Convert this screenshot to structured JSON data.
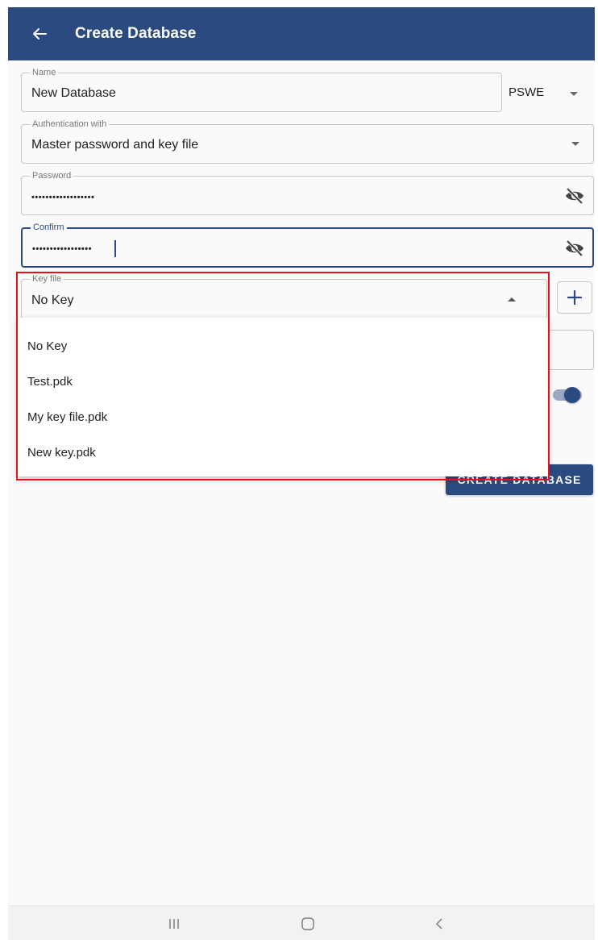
{
  "appbar": {
    "title": "Create Database"
  },
  "name_field": {
    "label": "Name",
    "value": "New Database"
  },
  "format_select": {
    "value": "PSWE"
  },
  "auth_field": {
    "label": "Authentication with",
    "value": "Master password and key file"
  },
  "password_field": {
    "label": "Password",
    "value": "••••••••••••••••••"
  },
  "confirm_field": {
    "label": "Confirm",
    "value": "•••••••••••••••••"
  },
  "keyfile_field": {
    "label": "Key file",
    "value": "No Key",
    "options": [
      "No Key",
      "Test.pdk",
      "My key file.pdk",
      "New key.pdk"
    ]
  },
  "create_button": {
    "label": "CREATE DATABASE"
  },
  "toggle": {
    "on": true
  },
  "colors": {
    "primary": "#2b4a80",
    "highlight": "#e8101a",
    "toggle_track": "#9aa8c6"
  },
  "icons": {
    "back": "arrow-left-icon",
    "visibility": "eye-off-icon",
    "add": "plus-icon",
    "nav_recent": "recents-icon",
    "nav_home": "home-icon",
    "nav_back": "chevron-left-icon"
  }
}
